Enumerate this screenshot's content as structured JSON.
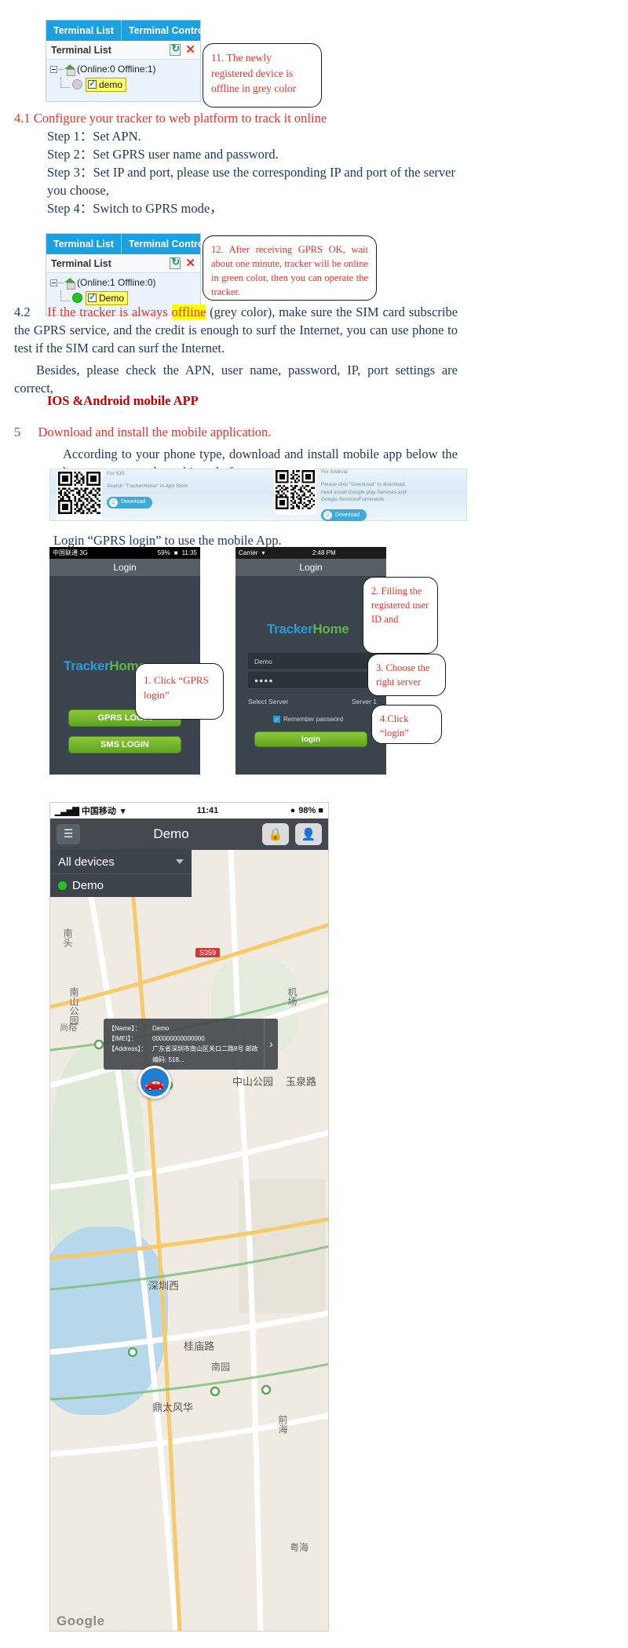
{
  "widget1": {
    "tabs": [
      "Terminal List",
      "Terminal Control"
    ],
    "panel_title": "Terminal List",
    "root_label": "(Online:0   Offline:1)",
    "node_label": "demo",
    "refresh_icon": "refresh-icon",
    "close_icon": "close-icon"
  },
  "callout11": {
    "text": "11. The newly registered device is offline in grey color"
  },
  "section41": {
    "heading": "4.1 Configure your tracker to web platform to track it online",
    "steps": [
      "Step 1：Set APN.",
      "Step 2：Set GPRS user name and password.",
      "Step 3：Set IP and port, please use the corresponding IP and port of the server you choose,",
      "Step 4：Switch to GPRS mode，"
    ]
  },
  "widget2": {
    "tabs": [
      "Terminal List",
      "Terminal Control"
    ],
    "panel_title": "Terminal List",
    "root_label": "(Online:1   Offline:0)",
    "node_label": "Demo"
  },
  "callout12": {
    "text": "12. After receiving GPRS OK, wait about one minute, tracker will be online in green color, then you can operate the tracker."
  },
  "section42": {
    "number": "4.2",
    "lead": "If the tracker is always",
    "highlight": "offline",
    "rest": "(grey color), make sure the SIM card subscribe the GPRS service, and the credit is enough to surf the Internet, you can use phone to test if the SIM card can surf the Internet.",
    "besides": "Besides, please check the APN, user name, password, IP, port settings are correct,"
  },
  "app_heading": "IOS &Android mobile APP",
  "section5": {
    "number": "5",
    "heading": "Download and install the mobile application.",
    "body": "According to your phone type, download and install mobile app below the home page on web tracking platform.",
    "login_line": "Login “GPRS login” to use the mobile App."
  },
  "qr_banner": {
    "ios": {
      "title": "For IOS",
      "desc": "Search \"TrackerHome\" in App Store",
      "download": "Download"
    },
    "android": {
      "title": "For Android",
      "desc": "Please click \"Download\" to download, need install Google play Services and Google ServicesFramework.",
      "download": "Download"
    }
  },
  "phone_android": {
    "status_left": "中国联通 3G",
    "status_right": "11:35",
    "battery": "59%",
    "title": "Login",
    "brand1": "Tracker",
    "brand2": "Home",
    "gprs_button": "GPRS LOGIN",
    "sms_button": "SMS LOGIN"
  },
  "phone_ios": {
    "status_left": "Carrier",
    "status_center": "2:48 PM",
    "title": "Login",
    "brand1": "Tracker",
    "brand2": "Home",
    "user_value": "Demo",
    "password_value": "●●●●",
    "server_label": "Select Server",
    "server_value": "Server 1",
    "remember_label": "Remember password",
    "login_button": "login"
  },
  "callout1": {
    "text": "1.  Click “GPRS login”"
  },
  "callout2": {
    "text": "2. Filling the registered user ID and"
  },
  "callout3": {
    "text": "3. Choose the right server"
  },
  "callout4": {
    "text": "4.Click “login”"
  },
  "map_shot": {
    "status_left": "中国移动",
    "status_time": "11:41",
    "status_battery": "98%",
    "menu_icon": "hamburger-icon",
    "title": "Demo",
    "lock_icon": "lock-icon",
    "user_icon": "user-icon",
    "device_selector": "All devices",
    "device_item": "Demo",
    "info": {
      "rows": [
        {
          "key": "【Name】：",
          "value": "Demo"
        },
        {
          "key": "【IMEI】：",
          "value": "000000000000000"
        },
        {
          "key": "【Address】：",
          "value": "广东省深圳市南山区关口二路8号 邮政编码: 518..."
        }
      ]
    },
    "labels": [
      "S359",
      "南山公园",
      "中山公园",
      "玉泉路",
      "深圳西",
      "桂庙路",
      "南园",
      "鼎太风华",
      "南头",
      "尚榕",
      "机场",
      "前海",
      "粤海"
    ],
    "watermark": "Google"
  }
}
